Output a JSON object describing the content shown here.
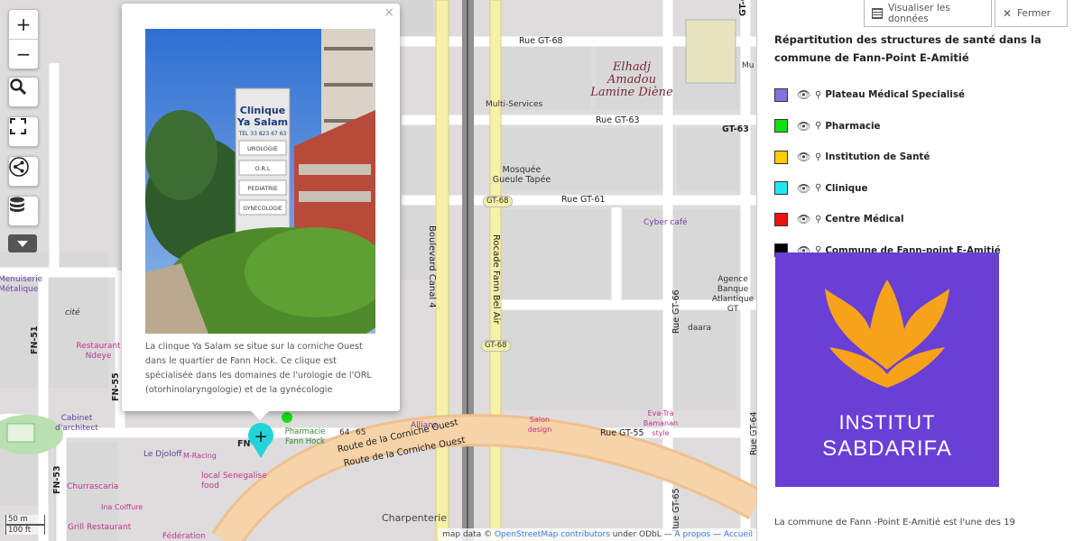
{
  "map": {
    "controls": {
      "zoom_in": "+",
      "zoom_out": "−"
    },
    "streets": {
      "gt68": "Rue GT-68",
      "gt63": "Rue GT-63",
      "gt63_right": "GT-63",
      "gt61": "Rue GT-61",
      "gt55": "Rue GT-55",
      "gt64_top": "GT-64",
      "gt64": "Rue GT-64",
      "gt66": "Rue GT-66",
      "gt65": "Rue GT-65",
      "boulevard": "Boulevard Canal 4",
      "rocade": "Rocade Fann Bel Air",
      "corniche1": "Route de la Corniche Ouest",
      "corniche2": "Route de la Corniche Ouest",
      "fn51": "FN-51",
      "fn55": "FN-55",
      "fn53": "FN-53",
      "fn": "FN"
    },
    "shields": {
      "gt68_a": "GT-68",
      "gt68_b": "GT-68"
    },
    "places": {
      "elhadj": "Elhadj Amadou Lamine Diène",
      "multi_services": "Multi-Services",
      "mosquee": "Mosquée Gueule Tapée",
      "cyber": "Cyber café",
      "agence": "Agence Banque Atlantique GT",
      "daara": "daara",
      "menuiserie": "Menuiserie Métalique",
      "cite": "cité",
      "restaurant": "Restaurant Ndeye",
      "cabinet": "Cabinet d'architect",
      "pharmacie": "Pharmacie Fann Hock",
      "allianz": "Allianz",
      "salon": "Salon design",
      "evatra": "Eva-Tra Bamanan style",
      "djoloff": "Le Djoloff",
      "racing": "M-Racing",
      "local": "local Senegalise food",
      "churrascaria": "Churrascaria",
      "coiffure": "Ina Coiffure",
      "grill": "Grill Restaurant",
      "federation": "Fédération",
      "charpenterie": "Charpenterie",
      "mu": "Mu",
      "num64": "64",
      "num65": "65"
    },
    "scale": {
      "metric": "50 m",
      "imperial": "100 ft"
    },
    "attribution": {
      "prefix": "map data © ",
      "osm": "OpenStreetMap contributors",
      "license": " under ODbL — ",
      "apropos": "A propos",
      "sep": " — ",
      "accueil": "Accueil"
    }
  },
  "popup": {
    "close": "×",
    "sign": {
      "name1": "Clinique",
      "name2": "Ya Salam",
      "phone": "TEL 33 823 67 63",
      "s1": "UROLOGIE",
      "s2": "O.R.L",
      "s3": "PEDIATRIE",
      "s4": "GYNECOLOGIE"
    },
    "description": "La clinque Ya Salam se situe sur la corniche Ouest dans le quartier de Fann Hock. Ce clique est spécialisée dans les domaines de l'urologie de l'ORL (otorhinolaryngologie) et de la gynécologie"
  },
  "panel": {
    "btn_data": "Visualiser les données",
    "btn_close": "Fermer",
    "title": "Répartitution des structures de santé dans la commune de Fann-Point E-Amitié",
    "legend": [
      {
        "label": "Plateau Médical Specialisé",
        "color": "#8a6fe0"
      },
      {
        "label": "Pharmacie",
        "color": "#11e011"
      },
      {
        "label": "Institution de Santé",
        "color": "#ffcc00"
      },
      {
        "label": "Clinique",
        "color": "#22e6f0"
      },
      {
        "label": "Centre Médical",
        "color": "#ee1111"
      },
      {
        "label": "Commune de Fann-point E-Amitié",
        "color": "#000000"
      }
    ],
    "logo": {
      "line1": "INSTITUT",
      "line2": "SABDARIFA",
      "bg": "#6a3fd6",
      "flower": "#f7a21b"
    },
    "paragraph": "La commune de Fann -Point E-Amitié est l'une des 19"
  }
}
